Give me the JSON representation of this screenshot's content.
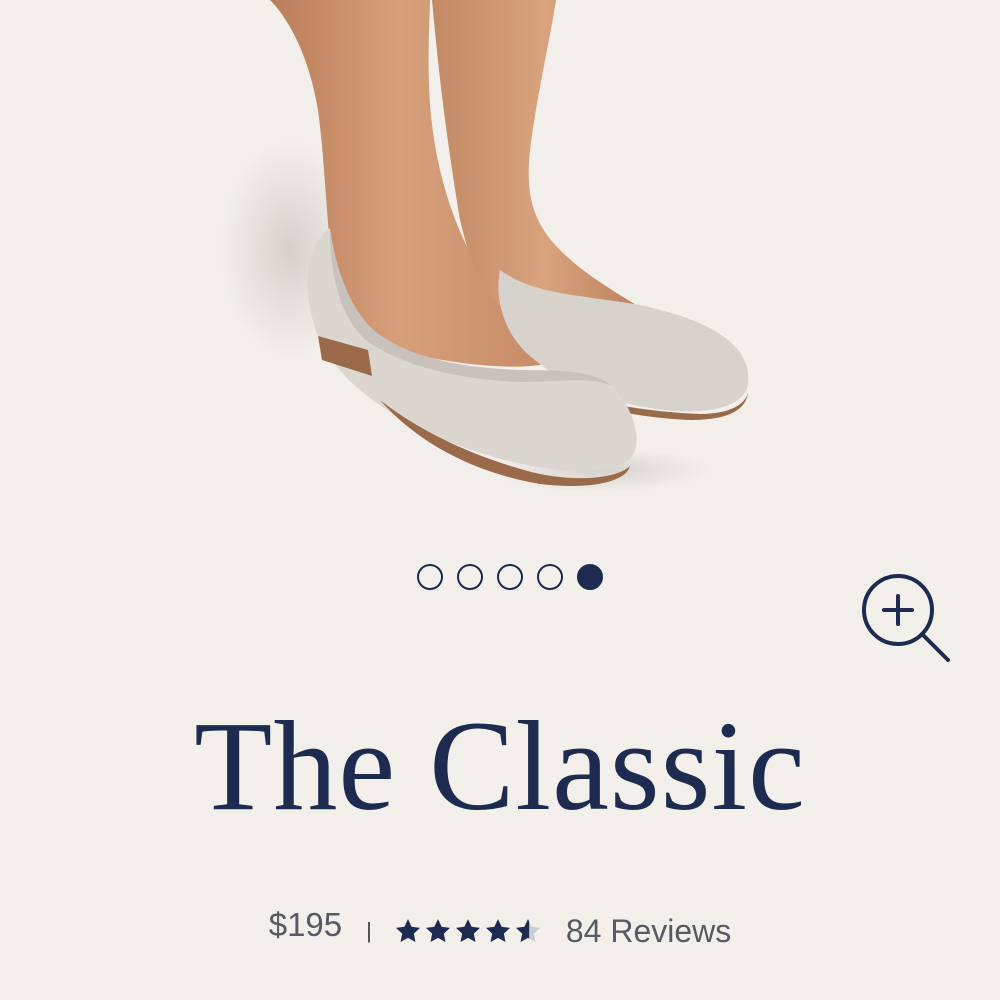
{
  "product": {
    "name": "The Classic",
    "price": "$195",
    "separator": "|",
    "rating": 4.5,
    "rating_max": 5,
    "reviews_label": "84 Reviews"
  },
  "gallery": {
    "image_count": 5,
    "active_index": 4,
    "image_subject": "legs-wearing-light-grey-ballet-flats"
  },
  "icons": {
    "zoom": "zoom-in-icon",
    "star": "star-icon"
  },
  "colors": {
    "background": "#f3f0ec",
    "navy": "#1c2b4f",
    "text_grey": "#555a63",
    "shoe": "#dad4cf",
    "sole": "#9b6a4a",
    "skin": "#cf9a74"
  }
}
